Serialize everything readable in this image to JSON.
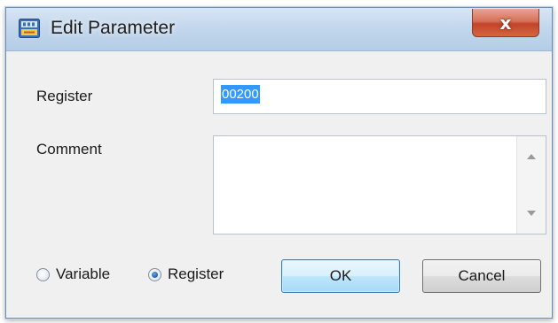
{
  "window": {
    "title": "Edit Parameter",
    "close_symbol": "x",
    "app_icon": "app-icon"
  },
  "form": {
    "register_label": "Register",
    "register_value": "00200",
    "comment_label": "Comment",
    "comment_value": ""
  },
  "type_options": {
    "variable_label": "Variable",
    "register_label": "Register",
    "selected": "Register"
  },
  "buttons": {
    "ok_label": "OK",
    "cancel_label": "Cancel"
  },
  "colors": {
    "selection": "#3399ff",
    "ok_border": "#3c7fb1",
    "close_button": "#c3432a"
  }
}
